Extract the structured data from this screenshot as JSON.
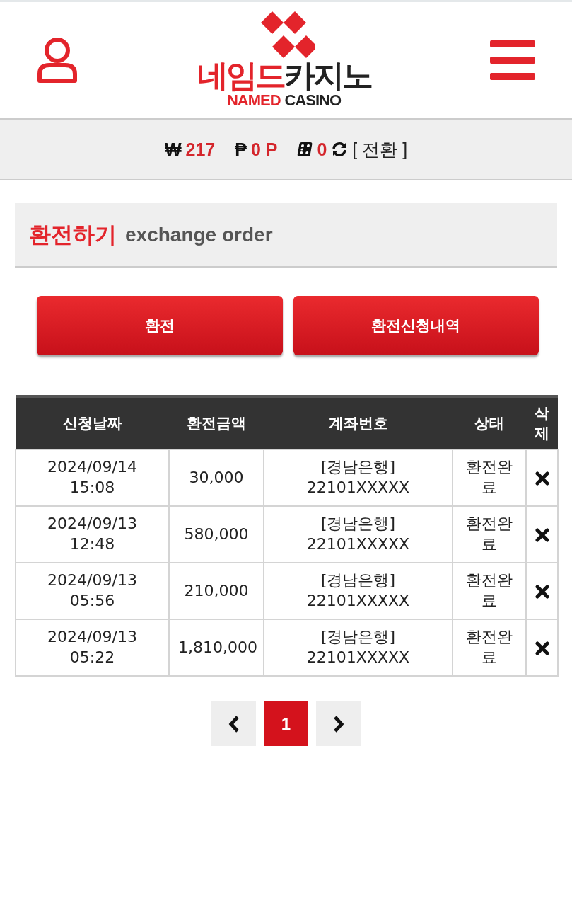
{
  "header": {
    "logo": {
      "korean_red": "네임드",
      "korean_dark": "카지노",
      "english_red": "NAMED",
      "english_dark": "CASINO"
    }
  },
  "balance_bar": {
    "won_symbol": "₩",
    "cash": "217",
    "point_symbol": "₱",
    "points": "0 P",
    "chips": "0",
    "convert_link": "[ 전환 ]"
  },
  "section_title": {
    "korean": "환전하기",
    "english": "exchange order"
  },
  "buttons": [
    "환전",
    "환전신청내역"
  ],
  "table": {
    "columns": [
      "신청날짜",
      "환전금액",
      "계좌번호",
      "상태",
      "삭제"
    ],
    "rows": [
      {
        "date": "2024/09/14",
        "time": "15:08",
        "amount": "30,000",
        "bank": "[경남은행]",
        "account": "22101XXXXX",
        "status": "환전완료"
      },
      {
        "date": "2024/09/13",
        "time": "12:48",
        "amount": "580,000",
        "bank": "[경남은행]",
        "account": "22101XXXXX",
        "status": "환전완료"
      },
      {
        "date": "2024/09/13",
        "time": "05:56",
        "amount": "210,000",
        "bank": "[경남은행]",
        "account": "22101XXXXX",
        "status": "환전완료"
      },
      {
        "date": "2024/09/13",
        "time": "05:22",
        "amount": "1,810,000",
        "bank": "[경남은행]",
        "account": "22101XXXXX",
        "status": "환전완료"
      }
    ]
  },
  "pagination": {
    "pages": [
      {
        "label": "1",
        "selected": true
      }
    ]
  }
}
